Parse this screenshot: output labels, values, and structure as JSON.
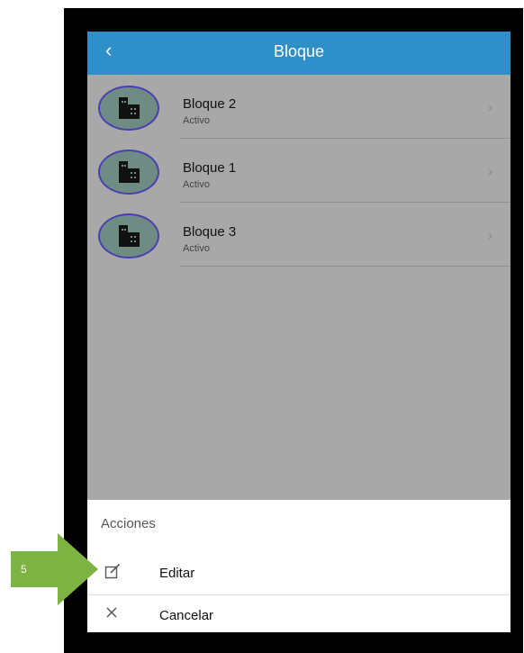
{
  "header": {
    "title": "Bloque",
    "back_icon": "chevron-left-icon"
  },
  "list": {
    "items": [
      {
        "name": "Bloque 2",
        "status": "Activo"
      },
      {
        "name": "Bloque 1",
        "status": "Activo"
      },
      {
        "name": "Bloque 3",
        "status": "Activo"
      }
    ]
  },
  "sheet": {
    "title": "Acciones",
    "actions": [
      {
        "label": "Editar",
        "icon": "edit-icon"
      },
      {
        "label": "Cancelar",
        "icon": "close-icon"
      }
    ]
  },
  "callout": {
    "label": "5",
    "color": "#7cb342"
  },
  "colors": {
    "header": "#2f8fc9",
    "overlay": "#a8a8a8",
    "frame": "#000000"
  }
}
